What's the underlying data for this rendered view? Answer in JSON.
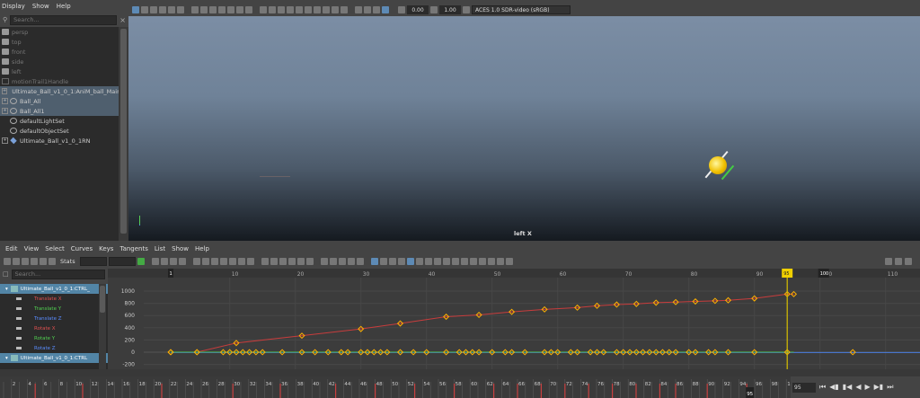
{
  "outliner": {
    "menu": [
      "Display",
      "Show",
      "Help"
    ],
    "search_placeholder": "Search...",
    "items": [
      {
        "label": "persp",
        "type": "camera",
        "dim": true
      },
      {
        "label": "top",
        "type": "camera",
        "dim": true
      },
      {
        "label": "front",
        "type": "camera",
        "dim": true
      },
      {
        "label": "side",
        "type": "camera",
        "dim": true
      },
      {
        "label": "left",
        "type": "camera",
        "dim": true
      },
      {
        "label": "motionTrail1Handle",
        "type": "node",
        "dim": true
      },
      {
        "label": "Ultimate_Ball_v1_0_1:AniM_ball_Main",
        "type": "ref",
        "selected": true
      },
      {
        "label": "Ball_All",
        "type": "set",
        "selected": true
      },
      {
        "label": "Ball_All1",
        "type": "set",
        "selected": true
      },
      {
        "label": "defaultLightSet",
        "type": "set"
      },
      {
        "label": "defaultObjectSet",
        "type": "set"
      },
      {
        "label": "Ultimate_Ball_v1_0_1RN",
        "type": "ref"
      }
    ]
  },
  "viewport": {
    "menu": [
      "View",
      "Shading",
      "Lighting",
      "Show",
      "Renderer",
      "Panels"
    ],
    "exposure": "0.00",
    "gamma": "1.00",
    "color_space": "ACES 1.0 SDR-video (sRGB)",
    "camera_label": "left X"
  },
  "graph_editor": {
    "menu": [
      "Edit",
      "View",
      "Select",
      "Curves",
      "Keys",
      "Tangents",
      "List",
      "Show",
      "Help"
    ],
    "stats_label": "Stats",
    "search_placeholder": "Search...",
    "node": "Ultimate_Ball_v1_0_1:CTRL_",
    "channels": [
      {
        "label": "Translate X",
        "color": "#e05050"
      },
      {
        "label": "Translate Y",
        "color": "#50d050"
      },
      {
        "label": "Translate Z",
        "color": "#5a8cff"
      },
      {
        "label": "Rotate X",
        "color": "#e05050"
      },
      {
        "label": "Rotate Y",
        "color": "#50d050"
      },
      {
        "label": "Rotate Z",
        "color": "#5a8cff"
      }
    ],
    "node2": "Ultimate_Ball_v1_0_1:CTRL",
    "y_ticks": [
      "1000",
      "800",
      "600",
      "400",
      "200",
      "0",
      "-200"
    ],
    "x_ticks": [
      "10",
      "20",
      "30",
      "40",
      "50",
      "60",
      "70",
      "80",
      "90",
      "100",
      "110"
    ],
    "start_marker": "1",
    "current_frame_marker": "95",
    "end_marker": "100"
  },
  "timeline": {
    "ticks": [
      "2",
      "4",
      "6",
      "8",
      "10",
      "12",
      "14",
      "16",
      "18",
      "20",
      "22",
      "24",
      "26",
      "28",
      "30",
      "32",
      "34",
      "36",
      "38",
      "40",
      "42",
      "44",
      "46",
      "48",
      "50",
      "52",
      "54",
      "56",
      "58",
      "60",
      "62",
      "64",
      "66",
      "68",
      "70",
      "72",
      "74",
      "76",
      "78",
      "80",
      "82",
      "84",
      "86",
      "88",
      "90",
      "92",
      "94",
      "96",
      "98",
      "100"
    ],
    "current_frame": "95",
    "frame_field": "95"
  }
}
